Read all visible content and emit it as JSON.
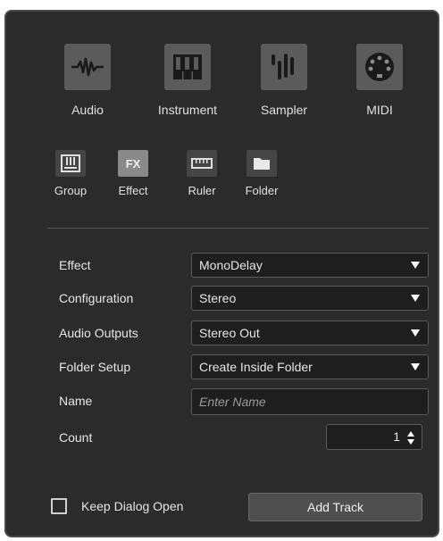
{
  "track_types_primary": [
    {
      "label": "Audio",
      "icon": "waveform-icon"
    },
    {
      "label": "Instrument",
      "icon": "piano-keys-icon"
    },
    {
      "label": "Sampler",
      "icon": "sampler-bars-icon"
    },
    {
      "label": "MIDI",
      "icon": "midi-connector-icon"
    }
  ],
  "track_types_secondary": [
    {
      "label": "Group",
      "icon": "group-fader-icon"
    },
    {
      "label": "Effect",
      "icon": "fx-icon",
      "icon_text": "FX",
      "selected": true
    },
    {
      "label": "Ruler",
      "icon": "ruler-icon"
    },
    {
      "label": "Folder",
      "icon": "folder-icon"
    }
  ],
  "form": {
    "effect": {
      "label": "Effect",
      "value": "MonoDelay"
    },
    "configuration": {
      "label": "Configuration",
      "value": "Stereo"
    },
    "audio_outputs": {
      "label": "Audio Outputs",
      "value": "Stereo Out"
    },
    "folder_setup": {
      "label": "Folder Setup",
      "value": "Create Inside Folder"
    },
    "name": {
      "label": "Name",
      "placeholder": "Enter Name",
      "value": ""
    },
    "count": {
      "label": "Count",
      "value": "1"
    }
  },
  "footer": {
    "keep_dialog_open_label": "Keep Dialog Open",
    "keep_dialog_open_checked": false,
    "add_track_label": "Add Track"
  },
  "colors": {
    "dialog_bg": "#2b2b2b",
    "tile_bg": "#5b5b5b",
    "selected_tile_bg": "#8a8a8a",
    "field_bg": "#1e1e1e"
  }
}
